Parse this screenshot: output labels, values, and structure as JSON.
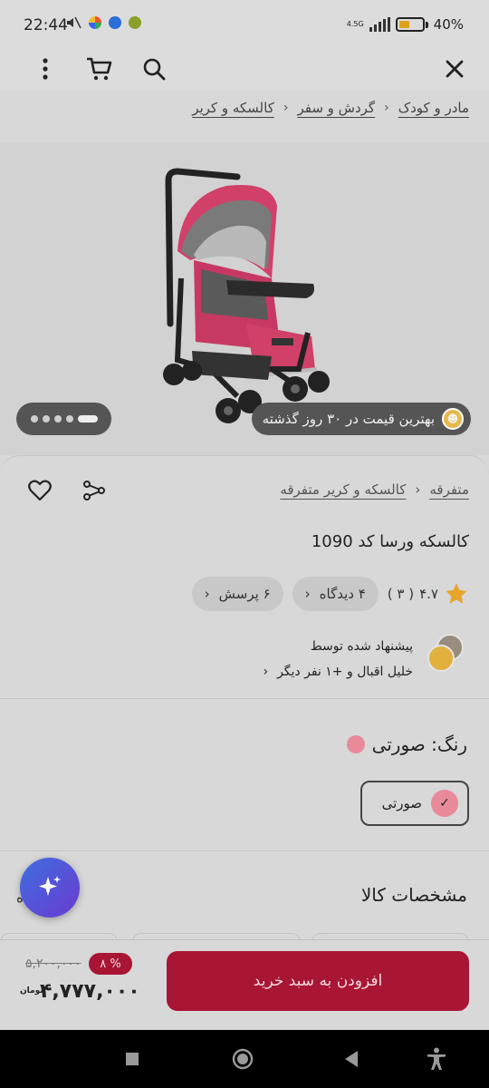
{
  "status_bar": {
    "time": "22:44",
    "network": "4.5G",
    "battery": "40%"
  },
  "toolbar": {
    "close_icon": "close-icon",
    "search_icon": "search-icon",
    "cart_icon": "cart-icon",
    "more_icon": "more-vertical-icon"
  },
  "breadcrumb": {
    "items": [
      "مادر و کودک",
      "گردش و سفر",
      "کالسکه و کریر"
    ]
  },
  "hero": {
    "best_price_text": "بهترین قیمت در ۳۰ روز گذشته",
    "image_count": 5,
    "active_index": 0
  },
  "category": {
    "items": [
      "متفرقه",
      "کالسکه و کریر متفرقه"
    ]
  },
  "product": {
    "title": "کالسکه ورسا کد 1090",
    "rating": "۴.۷",
    "rating_count": "( ۳ )",
    "reviews_chip": "۴ دیدگاه",
    "questions_chip": "۶ پرسش"
  },
  "recommend": {
    "title": "پیشنهاد شده توسط",
    "subtitle": "خلیل اقبال و +۱ نفر دیگر"
  },
  "color": {
    "label": "رنگ: صورتی",
    "option": "صورتی",
    "swatch": "#e88a9a"
  },
  "specs": {
    "title": "مشخصات کالا",
    "link": "مشاهده"
  },
  "buy_bar": {
    "add_to_cart": "افزودن به سبد خرید",
    "old_price": "۵,۲۰۰,۰۰۰",
    "discount": "۸ %",
    "price": "۴,۷۷۷,۰۰۰",
    "currency": "تومان",
    "accent": "#a81535"
  }
}
